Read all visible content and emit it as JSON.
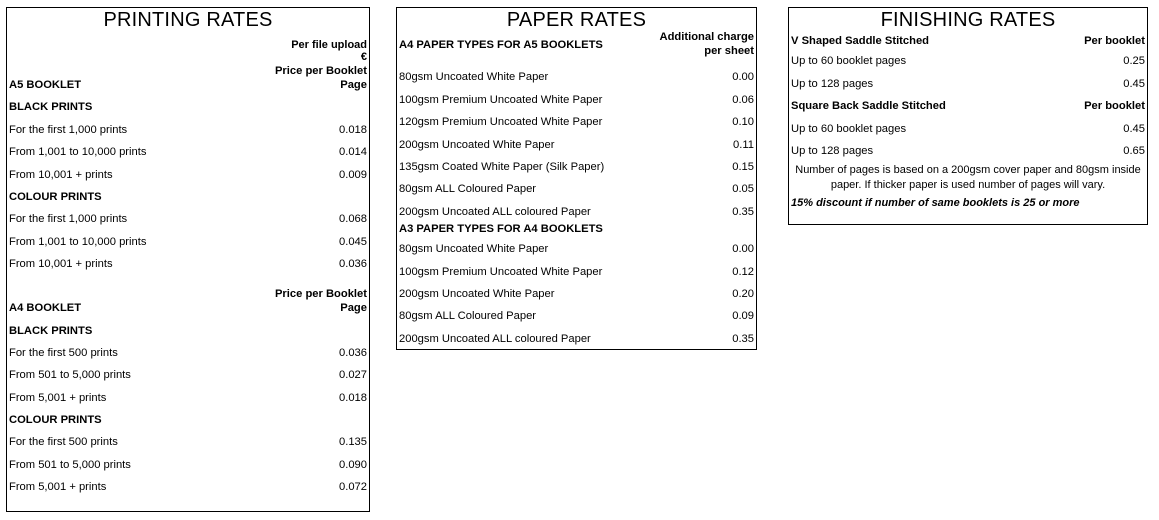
{
  "printing": {
    "title": "PRINTING RATES",
    "header": {
      "line1": "Per file upload",
      "line2": "€",
      "line3": "Price per Booklet",
      "line4": "Page"
    },
    "a5": {
      "label": "A5 BOOKLET",
      "black_label": "BLACK PRINTS",
      "black": [
        {
          "label": "For the first 1,000 prints",
          "value": "0.018"
        },
        {
          "label": "From 1,001 to 10,000 prints",
          "value": "0.014"
        },
        {
          "label": "From 10,001 + prints",
          "value": "0.009"
        }
      ],
      "colour_label": "COLOUR PRINTS",
      "colour": [
        {
          "label": "For the first 1,000 prints",
          "value": "0.068"
        },
        {
          "label": "From 1,001 to 10,000 prints",
          "value": "0.045"
        },
        {
          "label": "From 10,001 + prints",
          "value": "0.036"
        }
      ]
    },
    "a4_header": {
      "line1": "Price per Booklet",
      "line2": "Page"
    },
    "a4": {
      "label": "A4 BOOKLET",
      "black_label": "BLACK PRINTS",
      "black": [
        {
          "label": "For the first 500 prints",
          "value": "0.036"
        },
        {
          "label": "From 501 to 5,000 prints",
          "value": "0.027"
        },
        {
          "label": "From 5,001 + prints",
          "value": "0.018"
        }
      ],
      "colour_label": "COLOUR PRINTS",
      "colour": [
        {
          "label": "For the first 500 prints",
          "value": "0.135"
        },
        {
          "label": "From 501 to 5,000 prints",
          "value": "0.090"
        },
        {
          "label": "From 5,001 + prints",
          "value": "0.072"
        }
      ]
    }
  },
  "paper": {
    "title": "PAPER RATES",
    "a5_label": "A4 PAPER TYPES FOR A5 BOOKLETS",
    "charge_line1": "Additional charge",
    "charge_line2": "per sheet",
    "a5": [
      {
        "label": "80gsm Uncoated White Paper",
        "value": "0.00"
      },
      {
        "label": "100gsm Premium Uncoated White Paper",
        "value": "0.06"
      },
      {
        "label": "120gsm Premium Uncoated White Paper",
        "value": "0.10"
      },
      {
        "label": "200gsm Uncoated White Paper",
        "value": "0.11"
      },
      {
        "label": "135gsm Coated White Paper (Silk Paper)",
        "value": "0.15"
      },
      {
        "label": "80gsm ALL Coloured Paper",
        "value": "0.05"
      },
      {
        "label": "200gsm Uncoated ALL coloured Paper",
        "value": "0.35"
      }
    ],
    "a4_label": "A3 PAPER TYPES FOR A4 BOOKLETS",
    "a4": [
      {
        "label": "80gsm Uncoated White Paper",
        "value": "0.00"
      },
      {
        "label": "100gsm Premium Uncoated White Paper",
        "value": "0.12"
      },
      {
        "label": "200gsm Uncoated White Paper",
        "value": "0.20"
      },
      {
        "label": "80gsm ALL Coloured Paper",
        "value": "0.09"
      },
      {
        "label": "200gsm Uncoated ALL coloured Paper",
        "value": "0.35"
      }
    ]
  },
  "finishing": {
    "title": "FINISHING RATES",
    "v_label": "V Shaped Saddle Stitched",
    "v_unit": "Per booklet",
    "v": [
      {
        "label": "Up to 60 booklet pages",
        "value": "0.25"
      },
      {
        "label": "Up to 128 pages",
        "value": "0.45"
      }
    ],
    "sq_label": "Square Back Saddle Stitched",
    "sq_unit": "Per booklet",
    "sq": [
      {
        "label": "Up to 60 booklet pages",
        "value": "0.45"
      },
      {
        "label": "Up to 128 pages",
        "value": "0.65"
      }
    ],
    "note": "Number of pages is based on a 200gsm cover paper and 80gsm inside paper. If thicker paper is used number of pages will vary.",
    "discount": "15% discount if number of same booklets is 25 or more"
  }
}
